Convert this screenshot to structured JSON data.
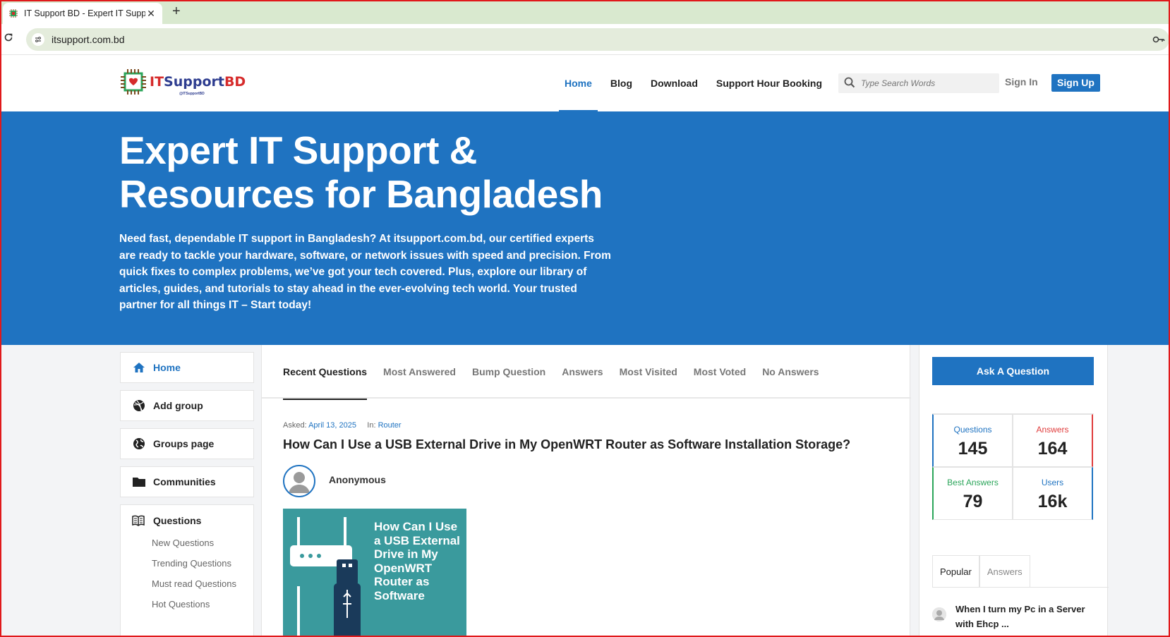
{
  "browser": {
    "tab_title": "IT Support BD - Expert IT Suppo",
    "close_glyph": "✕",
    "new_tab_glyph": "+",
    "url": "itsupport.com.bd"
  },
  "header": {
    "logo_it": "IT",
    "logo_support": "Support",
    "logo_bd": "BD",
    "logo_handle": "@ITSupportBD",
    "nav": [
      "Home",
      "Blog",
      "Download",
      "Support Hour Booking"
    ],
    "search_placeholder": "Type Search Words",
    "signin": "Sign In",
    "signup": "Sign Up"
  },
  "hero": {
    "title": "Expert IT Support & Resources for Bangladesh",
    "text": "Need fast, dependable IT support in Bangladesh? At itsupport.com.bd, our certified experts are ready to tackle your hardware, software, or network issues with speed and precision. From quick fixes to complex problems, we’ve got your tech covered. Plus, explore our library of articles, guides, and tutorials to stay ahead in the ever-evolving tech world. Your trusted partner for all things IT – Start today!"
  },
  "sidebar": {
    "items": [
      {
        "label": "Home",
        "icon": "home-icon"
      },
      {
        "label": "Add group",
        "icon": "dribbble-icon"
      },
      {
        "label": "Groups page",
        "icon": "globe-icon"
      },
      {
        "label": "Communities",
        "icon": "folder-icon"
      }
    ],
    "questions": {
      "label": "Questions",
      "icon": "book-icon",
      "sub": [
        "New Questions",
        "Trending Questions",
        "Must read Questions",
        "Hot Questions"
      ]
    }
  },
  "main": {
    "tabs": [
      "Recent Questions",
      "Most Answered",
      "Bump Question",
      "Answers",
      "Most Visited",
      "Most Voted",
      "No Answers"
    ],
    "question": {
      "asked_label": "Asked:",
      "date": "April 13, 2025",
      "in_label": "In:",
      "category": "Router",
      "title": "How Can I Use a USB External Drive in My OpenWRT Router as Software Installation Storage?",
      "author": "Anonymous",
      "thumb_text": "How Can I Use a USB External Drive in My OpenWRT Router as Software"
    }
  },
  "right": {
    "ask_button": "Ask A Question",
    "stats": [
      {
        "label": "Questions",
        "value": "145",
        "color": "#1f73c1"
      },
      {
        "label": "Answers",
        "value": "164",
        "color": "#e03c3c"
      },
      {
        "label": "Best Answers",
        "value": "79",
        "color": "#2ba55a"
      },
      {
        "label": "Users",
        "value": "16k",
        "color": "#1f73c1"
      }
    ],
    "tabs": [
      "Popular",
      "Answers"
    ],
    "popular_item": "When I turn my Pc in a Server with Ehcp ..."
  },
  "colors": {
    "accent": "#1f73c1",
    "hero_bg": "#1f73c1",
    "frame": "#e0191b"
  }
}
